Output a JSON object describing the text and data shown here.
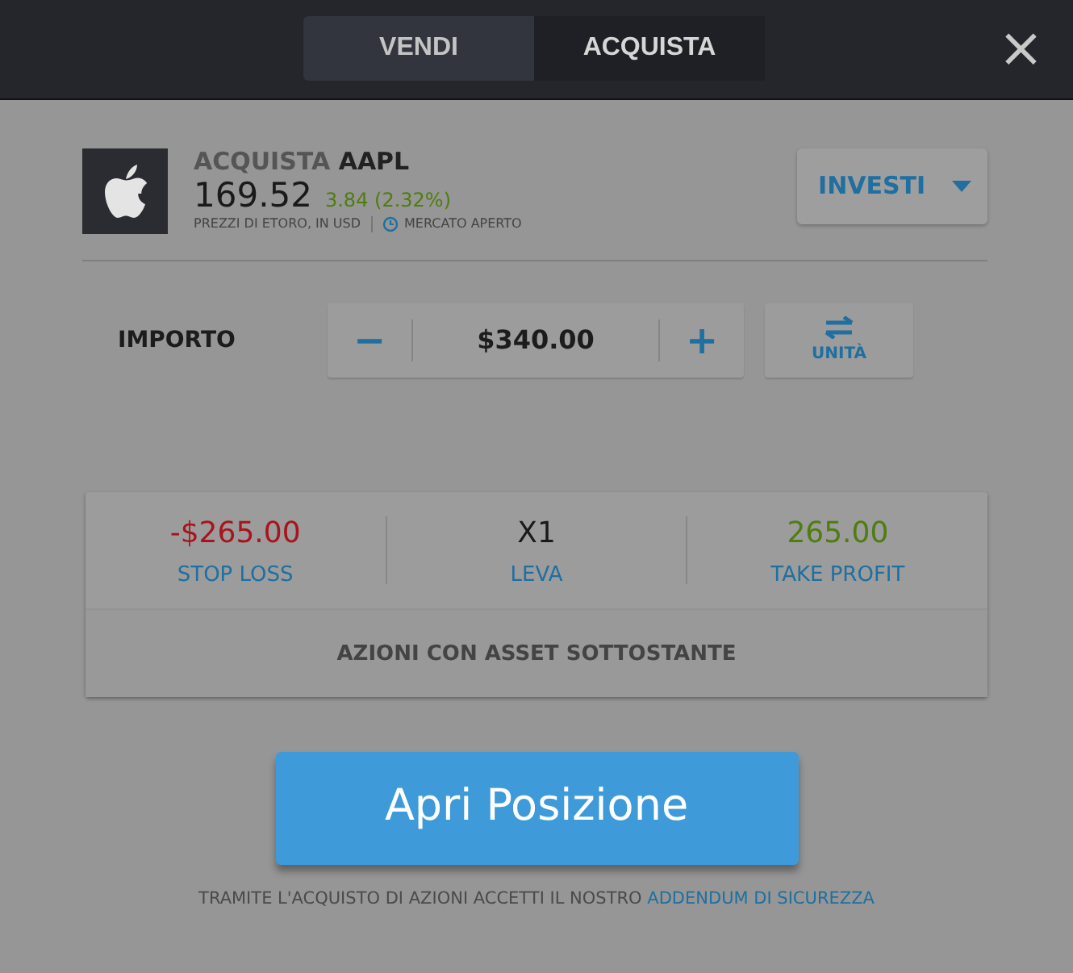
{
  "tabs": [
    {
      "label": "VENDI",
      "selected": false
    },
    {
      "label": "ACQUISTA",
      "selected": true
    }
  ],
  "close": "×",
  "instrument": {
    "action": "ACQUISTA",
    "symbol": "AAPL",
    "price": "169.52",
    "change": "3.84 (2.32%)",
    "source": "PREZZI DI ETORO, IN USD",
    "market": "MERCATO APERTO"
  },
  "order_type": {
    "label": "INVESTI"
  },
  "amount": {
    "label": "IMPORTO",
    "minus": "−",
    "value": "$340.00",
    "plus": "+",
    "units": "UNITÀ"
  },
  "params": [
    {
      "value": "-$265.00",
      "label": "STOP LOSS",
      "color": "#a8141b"
    },
    {
      "value": "X1",
      "label": "LEVA",
      "color": "#1a1a1a"
    },
    {
      "value": "265.00",
      "label": "TAKE PROFIT",
      "color": "#4f7d0f"
    }
  ],
  "asset_note": "AZIONI CON ASSET SOTTOSTANTE",
  "submit": "Apri Posizione",
  "footer": {
    "text": "TRAMITE L'ACQUISTO DI AZIONI ACCETTI IL NOSTRO",
    "link": "ADDENDUM DI SICUREZZA"
  }
}
